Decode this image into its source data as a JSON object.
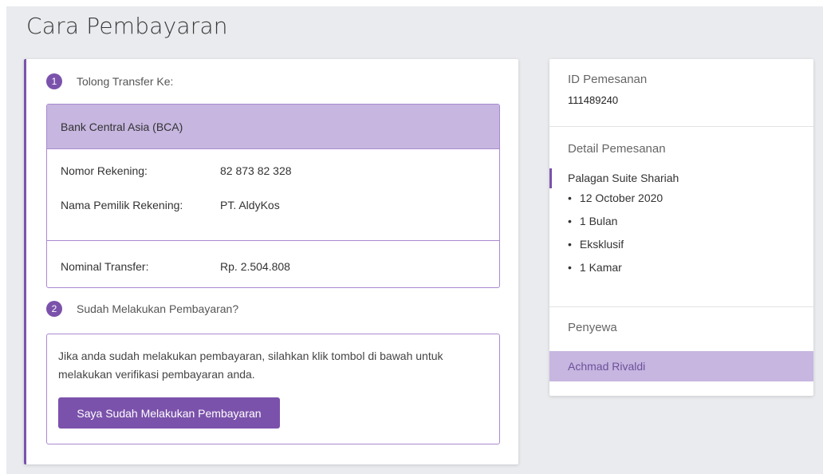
{
  "page": {
    "title": "Cara Pembayaran"
  },
  "steps": [
    {
      "number": "1",
      "label": "Tolong Transfer Ke:"
    },
    {
      "number": "2",
      "label": "Sudah Melakukan Pembayaran?"
    }
  ],
  "bank": {
    "name": "Bank Central Asia (BCA)",
    "account_number_label": "Nomor Rekening:",
    "account_number": "82 873 82 328",
    "owner_label": "Nama Pemilik Rekening:",
    "owner": "PT. AldyKos",
    "nominal_label": "Nominal Transfer:",
    "nominal_prefix": "Rp.",
    "nominal_amount": "2.504.808"
  },
  "confirmation": {
    "text": "Jika anda sudah melakukan pembayaran, silahkan klik tombol di bawah untuk melakukan verifikasi pembayaran anda.",
    "button_label": "Saya Sudah Melakukan Pembayaran"
  },
  "summary": {
    "id_title": "ID Pemesanan",
    "id_value": "111489240",
    "detail_title": "Detail Pemesanan",
    "hotel_name": "Palagan Suite Shariah",
    "details": [
      "12 October 2020",
      "1 Bulan",
      "Eksklusif",
      "1 Kamar"
    ],
    "tenant_title": "Penyewa",
    "tenant_name": "Achmad Rivaldi"
  },
  "colors": {
    "accent": "#7b52ab",
    "accent_light": "#c6b6e0",
    "background": "#e9ebee"
  }
}
